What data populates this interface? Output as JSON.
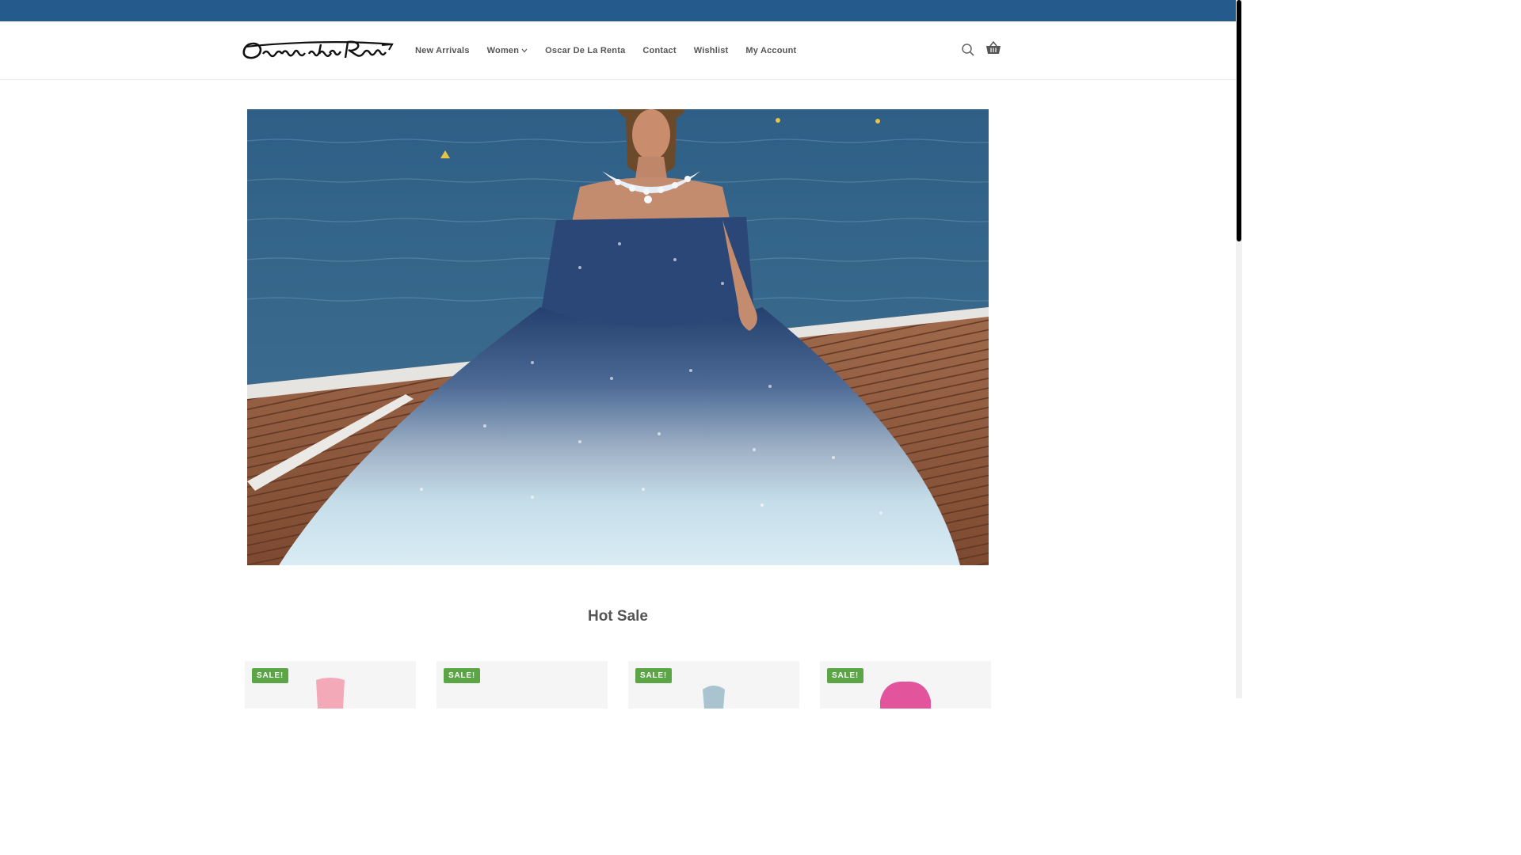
{
  "brand": {
    "logo_text": "Oscar de la Renta",
    "logo_icon": "oscar-de-la-renta-signature-logo"
  },
  "nav": {
    "items": [
      {
        "label": "New Arrivals"
      },
      {
        "label": "Women",
        "has_dropdown": true
      },
      {
        "label": "Oscar De La Renta"
      },
      {
        "label": "Contact"
      },
      {
        "label": "Wishlist"
      },
      {
        "label": "My Account"
      }
    ]
  },
  "header_icons": {
    "search": "search-icon",
    "cart": "basket-icon"
  },
  "hero": {
    "image": "woman in sequined blue-to-light-blue ball gown on a wooden dock by the sea"
  },
  "section": {
    "title": "Hot Sale"
  },
  "products": [
    {
      "badge": "SALE!",
      "thumb_color": "#f4a9b8"
    },
    {
      "badge": "SALE!",
      "thumb_color": "#7b6f66"
    },
    {
      "badge": "SALE!",
      "thumb_color": "#a9c3cf"
    },
    {
      "badge": "SALE!",
      "thumb_color": "#e2559c"
    }
  ],
  "colors": {
    "topbar": "#245a8c",
    "sale_badge": "#5ba546",
    "nav_text": "#555555"
  }
}
